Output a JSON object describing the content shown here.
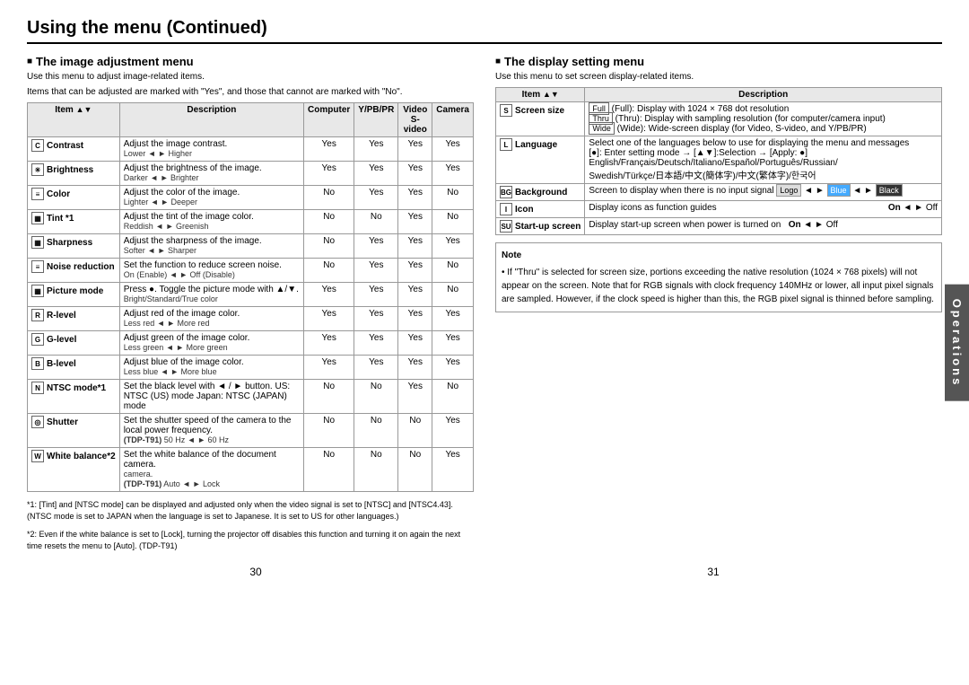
{
  "page": {
    "title": "Using the menu (Continued)",
    "page_left": "30",
    "page_right": "31"
  },
  "left": {
    "section_title": "The image adjustment menu",
    "section_desc": "Use this menu to adjust image-related items.",
    "section_desc2": "Items that can be adjusted are marked with \"Yes\", and those that cannot are marked with \"No\".",
    "col_item": "Item",
    "col_desc": "Description",
    "col_computer": "Computer",
    "col_ypbpr": "Y/PB/PR",
    "col_svideo": "Video S-video",
    "col_camera": "Camera",
    "rows": [
      {
        "name": "Contrast",
        "icon": "C",
        "desc": "Adjust the image contrast.",
        "subdesc": "Lower ◄ ► Higher",
        "computer": "Yes",
        "ypbpr": "Yes",
        "svideo": "Yes",
        "camera": "Yes"
      },
      {
        "name": "Brightness",
        "icon": "☀",
        "desc": "Adjust the brightness of the image.",
        "subdesc": "Darker ◄ ► Brighter",
        "computer": "Yes",
        "ypbpr": "Yes",
        "svideo": "Yes",
        "camera": "Yes"
      },
      {
        "name": "Color",
        "icon": "≡",
        "desc": "Adjust the color of the image.",
        "subdesc": "Lighter ◄ ► Deeper",
        "computer": "No",
        "ypbpr": "Yes",
        "svideo": "Yes",
        "camera": "No"
      },
      {
        "name": "Tint *1",
        "icon": "▦",
        "desc": "Adjust the tint of the image color.",
        "subdesc": "Reddish ◄ ► Greenish",
        "computer": "No",
        "ypbpr": "No",
        "svideo": "Yes",
        "camera": "No"
      },
      {
        "name": "Sharpness",
        "icon": "▦",
        "desc": "Adjust the sharpness of the image.",
        "subdesc": "Softer ◄ ► Sharper",
        "computer": "No",
        "ypbpr": "Yes",
        "svideo": "Yes",
        "camera": "Yes"
      },
      {
        "name": "Noise reduction",
        "icon": "≡",
        "desc": "Set the function to reduce screen noise.",
        "subdesc": "On (Enable) ◄ ► Off (Disable)",
        "computer": "No",
        "ypbpr": "Yes",
        "svideo": "Yes",
        "camera": "No"
      },
      {
        "name": "Picture mode",
        "icon": "▦",
        "desc": "Press ●. Toggle the picture mode with ▲/▼.",
        "subdesc": "Bright/Standard/True color",
        "computer": "Yes",
        "ypbpr": "Yes",
        "svideo": "Yes",
        "camera": "No"
      },
      {
        "name": "R-level",
        "icon": "R",
        "desc": "Adjust red of the image color.",
        "subdesc": "Less red ◄ ► More red",
        "computer": "Yes",
        "ypbpr": "Yes",
        "svideo": "Yes",
        "camera": "Yes"
      },
      {
        "name": "G-level",
        "icon": "G",
        "desc": "Adjust green of the image color.",
        "subdesc": "Less green ◄ ► More green",
        "computer": "Yes",
        "ypbpr": "Yes",
        "svideo": "Yes",
        "camera": "Yes"
      },
      {
        "name": "B-level",
        "icon": "B",
        "desc": "Adjust blue of the image color.",
        "subdesc": "Less blue ◄ ► More blue",
        "computer": "Yes",
        "ypbpr": "Yes",
        "svideo": "Yes",
        "camera": "Yes"
      },
      {
        "name": "NTSC mode*1",
        "icon": "N",
        "desc": "Set the black level with ◄ / ► button.\nUS:    NTSC (US) mode\nJapan: NTSC (JAPAN) mode",
        "subdesc": "",
        "computer": "No",
        "ypbpr": "No",
        "svideo": "Yes",
        "camera": "No"
      },
      {
        "name": "Shutter",
        "icon": "◎",
        "desc": "Set the shutter speed of the camera to the local power frequency.",
        "subdesc": "(TDP-T91)  50 Hz ◄ ► 60 Hz",
        "computer": "No",
        "ypbpr": "No",
        "svideo": "No",
        "camera": "Yes"
      },
      {
        "name": "White balance*2",
        "icon": "W",
        "desc": "Set the white balance of the document camera.",
        "subdesc": "(TDP-T91)  Auto ◄ ► Lock",
        "computer": "No",
        "ypbpr": "No",
        "svideo": "No",
        "camera": "Yes"
      }
    ],
    "footnote1": "*1: [Tint] and [NTSC mode] can be displayed and adjusted only when the video signal is set to [NTSC] and [NTSC4.43]. (NTSC mode is set to JAPAN when the language is set to Japanese. It is set to US for other languages.)",
    "footnote2": "*2: Even if the white balance is set to [Lock], turning the projector off disables this function and turning it on again the next time resets the menu to [Auto]. (TDP-T91)"
  },
  "right": {
    "section_title": "The display setting menu",
    "section_desc": "Use this menu to set screen display-related items.",
    "col_item": "Item",
    "col_desc": "Description",
    "rows": [
      {
        "name": "Screen size",
        "icon": "S",
        "desc": "(Full): Display with 1024 × 768 dot resolution\n(Thru): Display with sampling resolution (for computer/camera input)\n(Wide): Wide-screen display (for Video, S-video, and Y/PB/PR)"
      },
      {
        "name": "Language",
        "icon": "L",
        "desc": "Select one of the languages below to use for displaying the menu and messages\n[●]: Enter setting mode → [▲▼]:Selection → [Apply: ●]\nEnglish/Français/Deutsch/Italiano/Español/Português/Russian/\nSwedish/Türkçe/日本語/中文(簡体字)/中文(繁体字)/한국어"
      },
      {
        "name": "Background",
        "icon": "BG",
        "desc": "Screen to display when there is no input signal  [Logo] ◄ ► [Blue] ◄ ► [Black]"
      },
      {
        "name": "Icon",
        "icon": "I",
        "desc": "Display icons as function guides",
        "ondesc": "On ◄ ► Off"
      },
      {
        "name": "Start-up screen",
        "icon": "SU",
        "desc": "Display start-up screen when power is turned on  On ◄ ► Off"
      }
    ],
    "note_title": "Note",
    "note_text": "• If \"Thru\" is selected for screen size, portions exceeding the native resolution (1024 × 768 pixels) will not appear on the screen. Note that for RGB signals with clock frequency 140MHz or lower, all input pixel signals are sampled. However, if the clock speed is higher than this, the RGB pixel signal is thinned before sampling."
  },
  "operations_label": "Operations"
}
